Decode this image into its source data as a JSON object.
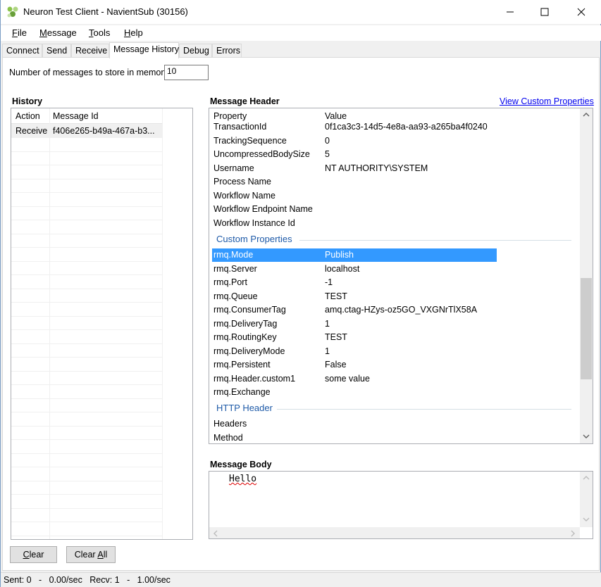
{
  "window": {
    "title": "Neuron Test Client - NavientSub (30156)",
    "icon": "neuron-app-icon",
    "controls": {
      "minimize": "—",
      "maximize": "☐",
      "close": "✕"
    }
  },
  "menu": [
    {
      "label": "File",
      "accel": "F",
      "rest": "ile"
    },
    {
      "label": "Message",
      "accel": "M",
      "rest": "essage"
    },
    {
      "label": "Tools",
      "accel": "T",
      "rest": "ools"
    },
    {
      "label": "Help",
      "accel": "H",
      "rest": "elp"
    }
  ],
  "tabs": [
    "Connect",
    "Send",
    "Receive",
    "Message History",
    "Debug",
    "Errors"
  ],
  "active_tab": "Message History",
  "store": {
    "label": "Number of messages to store in memory",
    "value": "10"
  },
  "history": {
    "title": "History",
    "columns": [
      "Action",
      "Message Id"
    ],
    "rows": [
      {
        "action": "Receive",
        "message_id": "f406e265-b49a-467a-b3..."
      }
    ]
  },
  "header": {
    "title": "Message Header",
    "link": "View Custom Properties",
    "columns": [
      "Property",
      "Value"
    ],
    "rows": [
      {
        "name": "TransactionId",
        "value": "0f1ca3c3-14d5-4e8a-aa93-a265ba4f0240"
      },
      {
        "name": "TrackingSequence",
        "value": "0"
      },
      {
        "name": "UncompressedBodySize",
        "value": "5"
      },
      {
        "name": "Username",
        "value": "NT AUTHORITY\\SYSTEM"
      },
      {
        "name": "Process Name",
        "value": ""
      },
      {
        "name": "Workflow Name",
        "value": ""
      },
      {
        "name": "Workflow Endpoint Name",
        "value": ""
      },
      {
        "name": "Workflow Instance Id",
        "value": ""
      }
    ],
    "custom_section": "Custom Properties",
    "custom_rows": [
      {
        "name": "rmq.Mode",
        "value": "Publish"
      },
      {
        "name": "rmq.Server",
        "value": "localhost"
      },
      {
        "name": "rmq.Port",
        "value": "-1"
      },
      {
        "name": "rmq.Queue",
        "value": "TEST"
      },
      {
        "name": "rmq.ConsumerTag",
        "value": "amq.ctag-HZys-oz5GO_VXGNrTlX58A"
      },
      {
        "name": "rmq.DeliveryTag",
        "value": "1"
      },
      {
        "name": "rmq.RoutingKey",
        "value": "TEST"
      },
      {
        "name": "rmq.DeliveryMode",
        "value": "1"
      },
      {
        "name": "rmq.Persistent",
        "value": "False"
      },
      {
        "name": "rmq.Header.custom1",
        "value": "some value"
      },
      {
        "name": "rmq.Exchange",
        "value": ""
      }
    ],
    "http_section": "HTTP Header",
    "http_rows": [
      {
        "name": "Headers",
        "value": ""
      },
      {
        "name": "Method",
        "value": ""
      }
    ]
  },
  "body": {
    "title": "Message Body",
    "text": "Hello"
  },
  "buttons": {
    "clear": {
      "accel": "C",
      "before": "",
      "after": "lear"
    },
    "clear_all": {
      "before": "Clear ",
      "accel": "A",
      "after": "ll"
    }
  },
  "status": "Sent: 0   -   0.00/sec   Recv: 1   -   1.00/sec",
  "colors": {
    "selection": "#3399ff",
    "section_heading": "#1e5aa8",
    "link": "#0000ee"
  }
}
